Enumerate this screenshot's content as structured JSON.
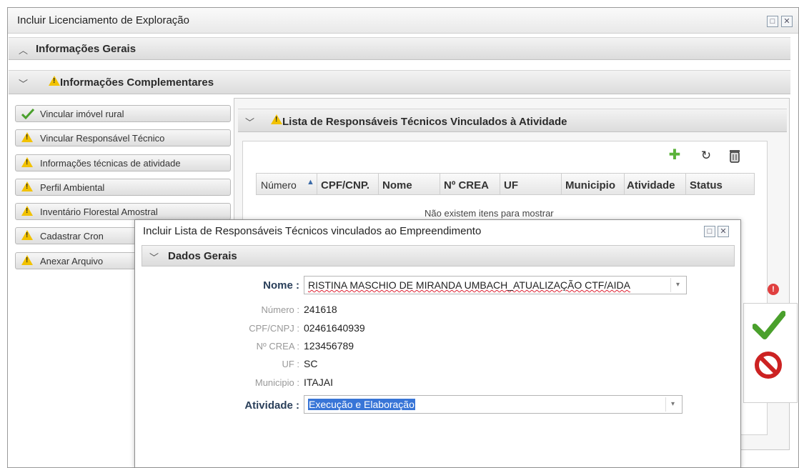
{
  "window": {
    "title": "Incluir Licenciamento de Exploração"
  },
  "sections": {
    "general": "Informações Gerais",
    "complementary": "Informações Complementares"
  },
  "nav": {
    "items": [
      {
        "label": "Vincular imóvel rural",
        "status": "check-icon"
      },
      {
        "label": "Vincular Responsável Técnico",
        "status": "warning-icon"
      },
      {
        "label": "Informações técnicas de atividade",
        "status": "warning-icon"
      },
      {
        "label": "Perfil Ambiental",
        "status": "warning-icon"
      },
      {
        "label": "Inventário Florestal Amostral",
        "status": "warning-icon"
      },
      {
        "label": "Cadastrar Cron",
        "status": "warning-icon"
      },
      {
        "label": "Anexar Arquivo",
        "status": "warning-icon"
      }
    ]
  },
  "list_panel": {
    "title": "Lista de Responsáveis Técnicos Vinculados à Atividade",
    "columns": [
      "Número",
      "CPF/CNP.",
      "Nome",
      "Nº CREA",
      "UF",
      "Municipio",
      "Atividade",
      "Status"
    ],
    "empty_text": "Não existem itens para mostrar",
    "tools": [
      "add-icon",
      "refresh-icon",
      "delete-icon"
    ]
  },
  "modal": {
    "title": "Incluir Lista de Responsáveis Técnicos vinculados ao Empreendimento",
    "section": "Dados Gerais",
    "fields": {
      "nome_label": "Nome :",
      "nome_value": "RISTINA MASCHIO DE MIRANDA UMBACH_ATUALIZAÇÃO CTF/AIDA",
      "numero_label": "Número :",
      "numero_value": "241618",
      "cpf_label": "CPF/CNPJ :",
      "cpf_value": "02461640939",
      "crea_label": "Nº CREA :",
      "crea_value": "123456789",
      "uf_label": "UF :",
      "uf_value": "SC",
      "municipio_label": "Municipio :",
      "municipio_value": "ITAJAI",
      "atividade_label": "Atividade :",
      "atividade_value": "Execução e Elaboração"
    }
  },
  "colors": {
    "warning": "#f2c200",
    "confirm": "#4aa02c",
    "cancel": "#cc2222",
    "selection": "#3875d7"
  }
}
